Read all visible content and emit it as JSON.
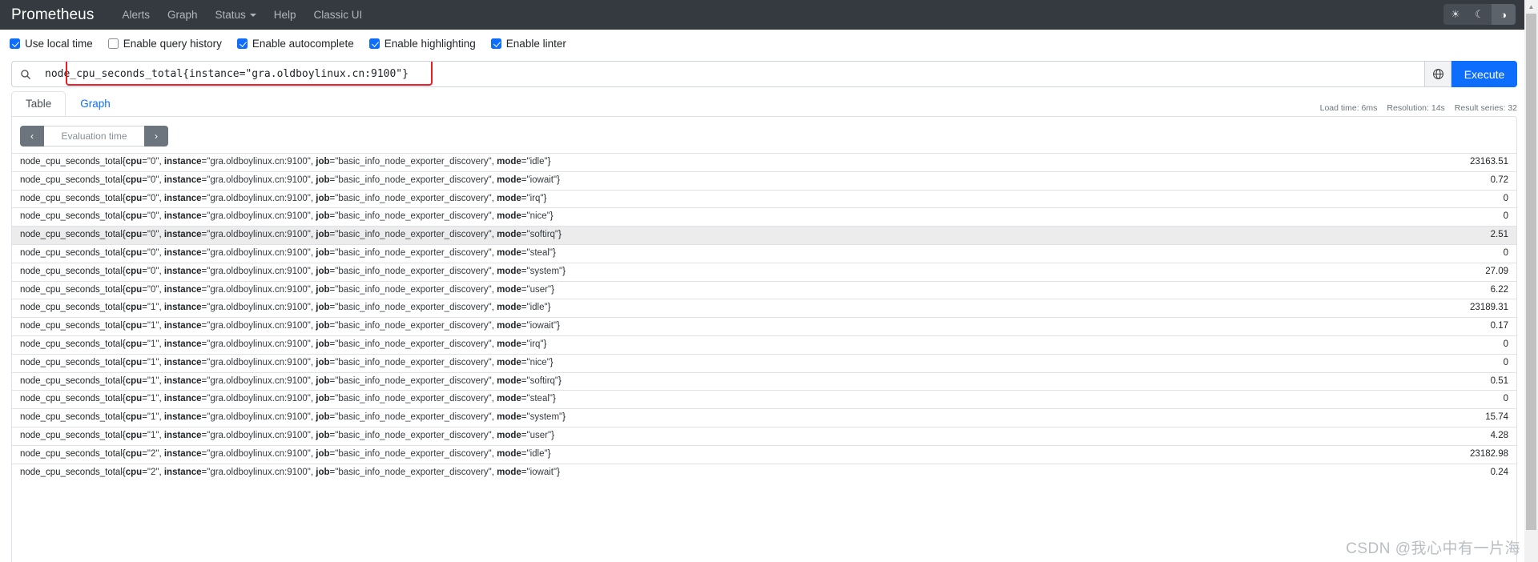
{
  "navbar": {
    "brand": "Prometheus",
    "links": [
      {
        "label": "Alerts",
        "has_caret": false
      },
      {
        "label": "Graph",
        "has_caret": false
      },
      {
        "label": "Status",
        "has_caret": true
      },
      {
        "label": "Help",
        "has_caret": false
      },
      {
        "label": "Classic UI",
        "has_caret": false
      }
    ],
    "theme_buttons": [
      {
        "icon": "sun-icon",
        "glyph": "☀",
        "active": false
      },
      {
        "icon": "moon-icon",
        "glyph": "☾",
        "active": false
      },
      {
        "icon": "half-circle-icon",
        "glyph": "◑",
        "active": true
      }
    ]
  },
  "options": [
    {
      "label": "Use local time",
      "checked": true
    },
    {
      "label": "Enable query history",
      "checked": false
    },
    {
      "label": "Enable autocomplete",
      "checked": true
    },
    {
      "label": "Enable highlighting",
      "checked": true
    },
    {
      "label": "Enable linter",
      "checked": true
    }
  ],
  "query": {
    "search_icon": "search-icon",
    "value": "node_cpu_seconds_total{instance=\"gra.oldboylinux.cn:9100\"}",
    "metrics_explorer_icon": "globe-icon",
    "execute_label": "Execute",
    "annotation_color": "#ee1c25"
  },
  "tabs": [
    {
      "label": "Table",
      "active": true
    },
    {
      "label": "Graph",
      "active": false
    }
  ],
  "stats": {
    "load_time": "Load time: 6ms",
    "resolution": "Resolution: 14s",
    "result_series": "Result series: 32"
  },
  "evaluation_time": {
    "prev_label": "‹",
    "placeholder": "Evaluation time",
    "next_label": "›"
  },
  "table": {
    "metric_name": "node_cpu_seconds_total",
    "instance": "gra.oldboylinux.cn:9100",
    "job": "basic_info_node_exporter_discovery",
    "rows": [
      {
        "cpu": "0",
        "mode": "idle",
        "value": "23163.51",
        "highlighted": false
      },
      {
        "cpu": "0",
        "mode": "iowait",
        "value": "0.72",
        "highlighted": false
      },
      {
        "cpu": "0",
        "mode": "irq",
        "value": "0",
        "highlighted": false
      },
      {
        "cpu": "0",
        "mode": "nice",
        "value": "0",
        "highlighted": false
      },
      {
        "cpu": "0",
        "mode": "softirq",
        "value": "2.51",
        "highlighted": true
      },
      {
        "cpu": "0",
        "mode": "steal",
        "value": "0",
        "highlighted": false
      },
      {
        "cpu": "0",
        "mode": "system",
        "value": "27.09",
        "highlighted": false
      },
      {
        "cpu": "0",
        "mode": "user",
        "value": "6.22",
        "highlighted": false
      },
      {
        "cpu": "1",
        "mode": "idle",
        "value": "23189.31",
        "highlighted": false
      },
      {
        "cpu": "1",
        "mode": "iowait",
        "value": "0.17",
        "highlighted": false
      },
      {
        "cpu": "1",
        "mode": "irq",
        "value": "0",
        "highlighted": false
      },
      {
        "cpu": "1",
        "mode": "nice",
        "value": "0",
        "highlighted": false
      },
      {
        "cpu": "1",
        "mode": "softirq",
        "value": "0.51",
        "highlighted": false
      },
      {
        "cpu": "1",
        "mode": "steal",
        "value": "0",
        "highlighted": false
      },
      {
        "cpu": "1",
        "mode": "system",
        "value": "15.74",
        "highlighted": false
      },
      {
        "cpu": "1",
        "mode": "user",
        "value": "4.28",
        "highlighted": false
      },
      {
        "cpu": "2",
        "mode": "idle",
        "value": "23182.98",
        "highlighted": false
      },
      {
        "cpu": "2",
        "mode": "iowait",
        "value": "0.24",
        "highlighted": false
      }
    ]
  },
  "watermark": "CSDN @我心中有一片海"
}
